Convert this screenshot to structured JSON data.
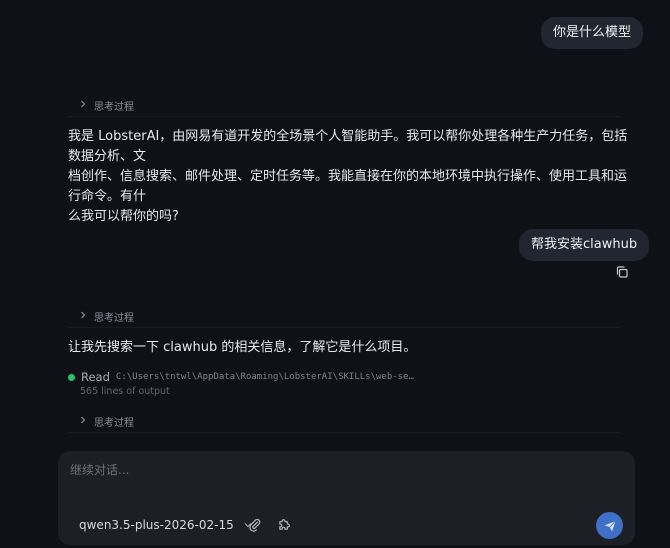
{
  "messages": {
    "user_1": "你是什么模型",
    "thinking_1": "思考过程",
    "assistant_1": "我是 LobsterAI，由网易有道开发的全场景个人智能助手。我可以帮你处理各种生产力任务，包括数据分析、文\n档创作、信息搜索、邮件处理、定时任务等。我能直接在你的本地环境中执行操作、使用工具和运行命令。有什\n么我可以帮你的吗?",
    "user_2": "帮我安装clawhub",
    "thinking_2": "思考过程",
    "assistant_2": "让我先搜索一下 clawhub 的相关信息，了解它是什么项目。",
    "tool": {
      "name": "Read",
      "path": "C:\\Users\\tntwl\\AppData\\Roaming\\LobsterAI\\SKILLs\\web-search\\...",
      "output": "565 lines of output",
      "status_color": "#27c46b"
    },
    "thinking_3": "思考过程"
  },
  "composer": {
    "placeholder": "继续对话...",
    "model": "qwen3.5-plus-2026-02-15",
    "send_color": "#3f6fc7"
  },
  "icons": {
    "thinking_chevron": "chevron-right-icon",
    "copy": "copy-icon",
    "model_chevron": "chevron-down-icon",
    "attach": "paperclip-icon",
    "skill": "puzzle-icon",
    "send": "send-icon"
  }
}
